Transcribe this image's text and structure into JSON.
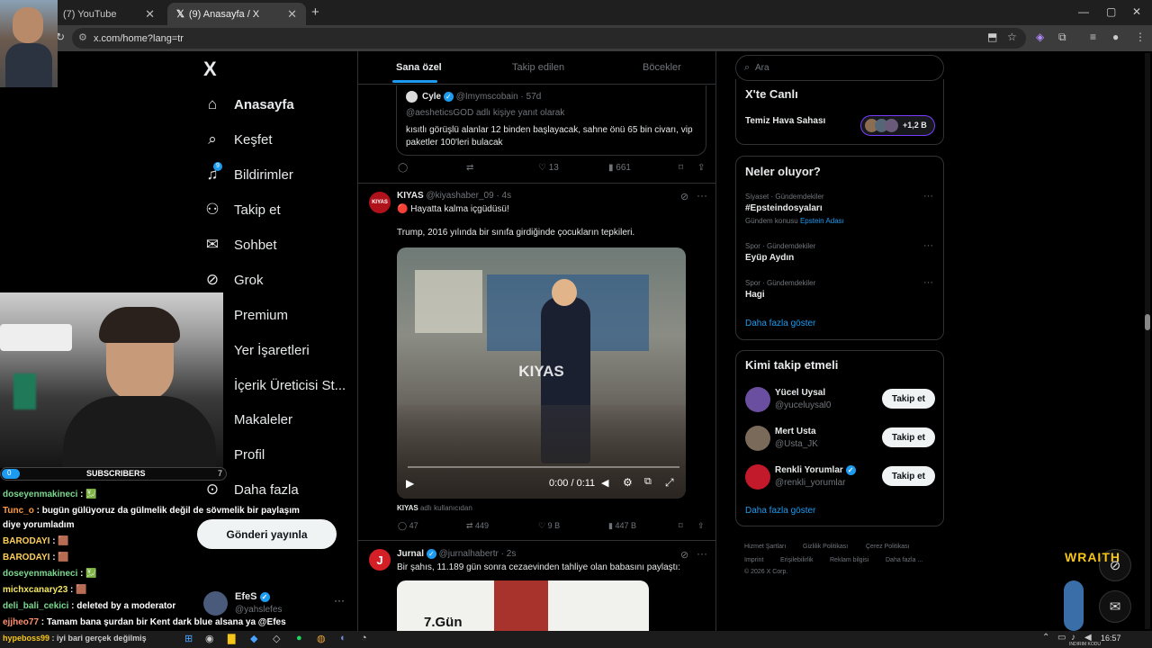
{
  "browser": {
    "tabs": [
      {
        "label": "(7) YouTube"
      },
      {
        "label": "(9) Anasayfa / X"
      }
    ],
    "new_tab": "+",
    "url": "x.com/home?lang=tr"
  },
  "nav": {
    "logo": "X",
    "items": [
      {
        "label": "Anasayfa",
        "icon": "home-icon"
      },
      {
        "label": "Keşfet",
        "icon": "search-icon"
      },
      {
        "label": "Bildirimler",
        "icon": "bell-icon",
        "badge": "9"
      },
      {
        "label": "Takip et",
        "icon": "add-user-icon"
      },
      {
        "label": "Sohbet",
        "icon": "mail-icon"
      },
      {
        "label": "Grok",
        "icon": "grok-icon"
      },
      {
        "label": "Premium",
        "icon": "premium-icon"
      },
      {
        "label": "Yer İşaretleri",
        "icon": "bookmark-icon"
      },
      {
        "label": "İçerik Üreticisi St...",
        "icon": "studio-icon"
      },
      {
        "label": "Makaleler",
        "icon": "article-icon"
      },
      {
        "label": "Profil",
        "icon": "profile-icon"
      },
      {
        "label": "Daha fazla",
        "icon": "more-circle-icon"
      }
    ],
    "post_button": "Gönderi yayınla",
    "account": {
      "name": "EfeS",
      "handle": "@yahslefes"
    }
  },
  "feed": {
    "tabs": [
      "Sana özel",
      "Takip edilen",
      "Böcekler"
    ],
    "quote": {
      "name": "Cyle",
      "handle": "@Imymscobain",
      "time": "· 57d",
      "reply_to": "@aesheticsGOD adlı kişiye yanıt olarak",
      "text": "kısıtlı görüşlü alanlar 12 binden başlayacak, sahne önü 65 bin civarı, vip paketler 100'leri bulacak"
    },
    "quote_actions": {
      "likes": "13",
      "views": "661"
    },
    "post1": {
      "avatar": "KIYAS",
      "name": "KIYAS",
      "handle": "@kiyashaber_09",
      "time": "· 4s",
      "line1": "🔴 Hayatta kalma içgüdüsü!",
      "line2": "Trump, 2016 yılında bir sınıfa girdiğinde çocukların tepkileri.",
      "watermark": "KIYAS",
      "video_time": "0:00 / 0:11",
      "credit_name": "KIYAS",
      "credit_rest": "adlı kullanıcıdan",
      "replies": "47",
      "reposts": "449",
      "likes": "9 B",
      "views": "447 B"
    },
    "post2": {
      "name": "Jurnal",
      "handle": "@jurnalhabertr",
      "time": "· 2s",
      "text": "Bir şahıs, 11.189 gün sonra cezaevinden tahliye olan babasını paylaştı:",
      "overlay": "7.Gün"
    }
  },
  "right": {
    "search_placeholder": "Ara",
    "live": {
      "title": "X'te Canlı",
      "item": "Temiz Hava Sahası",
      "count": "+1,2 B"
    },
    "trends": {
      "title": "Neler oluyor?",
      "items": [
        {
          "meta": "Siyaset · Gündemdekiler",
          "name": "#Epsteindosyaları",
          "extra_label": "Gündem konusu",
          "extra_link": "Epstein Adası"
        },
        {
          "meta": "Spor · Gündemdekiler",
          "name": "Eyüp Aydın"
        },
        {
          "meta": "Spor · Gündemdekiler",
          "name": "Hagi"
        }
      ],
      "more": "Daha fazla göster"
    },
    "follow": {
      "title": "Kimi takip etmeli",
      "items": [
        {
          "name": "Yücel Uysal",
          "handle": "@yuceluysal0",
          "button": "Takip et"
        },
        {
          "name": "Mert Usta",
          "handle": "@Usta_JK",
          "button": "Takip et"
        },
        {
          "name": "Renkli Yorumlar",
          "handle": "@renkli_yorumlar",
          "button": "Takip et"
        }
      ],
      "more": "Daha fazla göster"
    },
    "footer": {
      "links": [
        "Hizmet Şartları",
        "Gizlilik Politikası",
        "Çerez Politikası",
        "Imprint",
        "Erişilebilirlik",
        "Reklam bilgisi",
        "Daha fazla ..."
      ],
      "copyright": "© 2026 X Corp."
    }
  },
  "stream": {
    "subs_left": "0",
    "subs_label": "SUBSCRIBERS",
    "subs_right": "7",
    "chat": [
      {
        "user": "doseyenmakineci",
        "msg": " : 💹"
      },
      {
        "user": "Tunc_o",
        "msg": " : bugün gülüyoruz da gülmelik değil de sövmelik bir paylaşım"
      },
      {
        "user": "",
        "msg": "diye yorumladım"
      },
      {
        "user": "BARODAYI",
        "msg": " : 🟫"
      },
      {
        "user": "BARODAYI",
        "msg": " : 🟫"
      },
      {
        "user": "doseyenmakineci",
        "msg": " : 💹"
      },
      {
        "user": "michxcanary23",
        "msg": " : 🟫"
      },
      {
        "user": "deli_bali_cekici",
        "msg": " : deleted by a moderator"
      },
      {
        "user": "ejjheo77",
        "msg": " : Tamam bana şurdan bir Kent dark blue alsana ya @Efes"
      },
      {
        "user": "hypeboss99",
        "msg": " : iyi bari gerçek değilmiş"
      }
    ],
    "brand": "WRAITH",
    "brand_sub": "INDIRIM KODU"
  },
  "taskbar": {
    "time": "16:57"
  },
  "colors": {
    "accent": "#1d9bf0",
    "bg": "#000000",
    "border": "#2f3336",
    "muted": "#71767b"
  }
}
